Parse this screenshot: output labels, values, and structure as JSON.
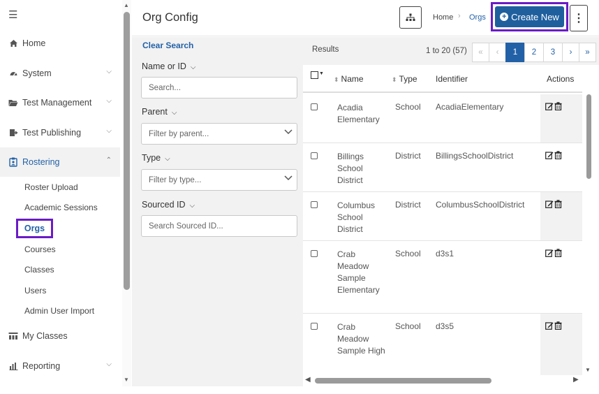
{
  "sidebar": {
    "menu_icon": "hamburger-icon",
    "items": [
      {
        "label": "Home",
        "icon": "home-icon"
      },
      {
        "label": "System",
        "icon": "gauge-icon"
      },
      {
        "label": "Test Management",
        "icon": "folder-icon"
      },
      {
        "label": "Test Publishing",
        "icon": "publish-icon"
      },
      {
        "label": "Rostering",
        "icon": "roster-icon"
      },
      {
        "label": "My Classes",
        "icon": "classes-icon"
      },
      {
        "label": "Reporting",
        "icon": "chart-icon"
      }
    ],
    "sub_items": [
      "Roster Upload",
      "Academic Sessions",
      "Orgs",
      "Courses",
      "Classes",
      "Users",
      "Admin User Import"
    ],
    "current": "Orgs"
  },
  "header": {
    "title": "Org Config",
    "breadcrumb": [
      "Home",
      "Orgs"
    ],
    "create_label": "Create New"
  },
  "filters": {
    "clear_label": "Clear Search",
    "name_label": "Name or ID",
    "name_placeholder": "Search...",
    "parent_label": "Parent",
    "parent_placeholder": "Filter by parent...",
    "type_label": "Type",
    "type_placeholder": "Filter by type...",
    "sourced_label": "Sourced ID",
    "sourced_placeholder": "Search Sourced ID..."
  },
  "results": {
    "label": "Results",
    "count": "1 to 20 (57)",
    "pager": [
      "«",
      "‹",
      "1",
      "2",
      "3",
      "›",
      "»"
    ],
    "current_page": "1",
    "columns": [
      "Name",
      "Type",
      "Identifier",
      "Actions"
    ],
    "rows": [
      {
        "name": "Acadia Elementary",
        "type": "School",
        "identifier": "AcadiaElementary"
      },
      {
        "name": "Billings School District",
        "type": "District",
        "identifier": "BillingsSchoolDistrict"
      },
      {
        "name": "Columbus School District",
        "type": "District",
        "identifier": "ColumbusSchoolDistrict"
      },
      {
        "name": "Crab Meadow Sample Elementary",
        "type": "School",
        "identifier": "d3s1"
      },
      {
        "name": "Crab Meadow Sample High",
        "type": "School",
        "identifier": "d3s5"
      }
    ]
  },
  "colors": {
    "accent": "#2361a7",
    "highlight": "#6a1bc7",
    "panel": "#f2f2f2"
  }
}
